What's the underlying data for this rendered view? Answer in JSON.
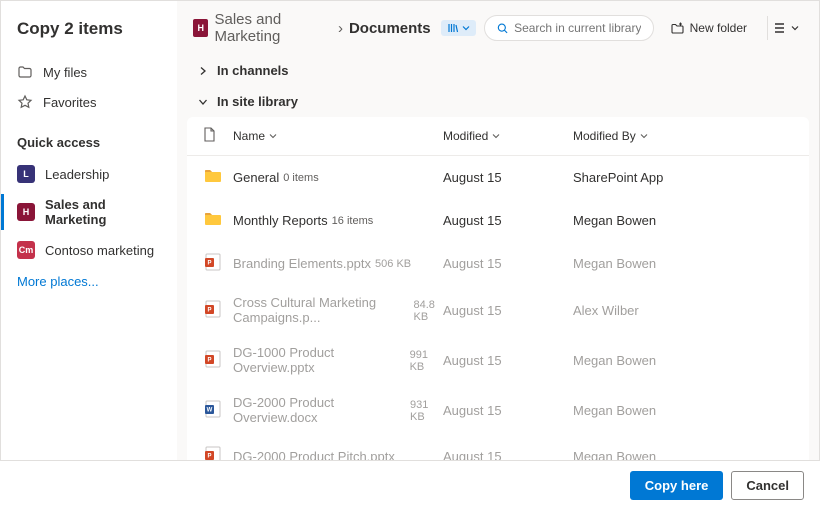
{
  "title": "Copy 2 items",
  "nav": {
    "my_files": "My files",
    "favorites": "Favorites"
  },
  "quick_access": {
    "header": "Quick access",
    "items": [
      {
        "label": "Leadership",
        "abbr": "L"
      },
      {
        "label": "Sales and Marketing",
        "abbr": "H"
      },
      {
        "label": "Contoso marketing",
        "abbr": "Cm"
      }
    ],
    "more": "More places..."
  },
  "breadcrumb": {
    "site_abbr": "H",
    "site": "Sales and Marketing",
    "current": "Documents"
  },
  "search_placeholder": "Search in current library",
  "new_folder": "New folder",
  "sections": {
    "channels": "In channels",
    "library": "In site library"
  },
  "columns": {
    "name": "Name",
    "modified": "Modified",
    "modified_by": "Modified By"
  },
  "rows": [
    {
      "type": "folder",
      "name": "General",
      "sub": "0 items",
      "modified": "August 15",
      "by": "SharePoint App",
      "dim": false
    },
    {
      "type": "folder",
      "name": "Monthly Reports",
      "sub": "16 items",
      "modified": "August 15",
      "by": "Megan Bowen",
      "dim": false
    },
    {
      "type": "pptx",
      "name": "Branding Elements.pptx",
      "sub": "506 KB",
      "modified": "August 15",
      "by": "Megan Bowen",
      "dim": true
    },
    {
      "type": "pptx",
      "name": "Cross Cultural Marketing Campaigns.p...",
      "sub": "84.8 KB",
      "modified": "August 15",
      "by": "Alex Wilber",
      "dim": true
    },
    {
      "type": "pptx",
      "name": "DG-1000 Product Overview.pptx",
      "sub": "991 KB",
      "modified": "August 15",
      "by": "Megan Bowen",
      "dim": true
    },
    {
      "type": "docx",
      "name": "DG-2000 Product Overview.docx",
      "sub": "931 KB",
      "modified": "August 15",
      "by": "Megan Bowen",
      "dim": true
    },
    {
      "type": "pptx",
      "name": "DG-2000 Product Pitch.pptx",
      "sub": "",
      "modified": "August 15",
      "by": "Megan Bowen",
      "dim": true
    }
  ],
  "buttons": {
    "copy": "Copy here",
    "cancel": "Cancel"
  }
}
